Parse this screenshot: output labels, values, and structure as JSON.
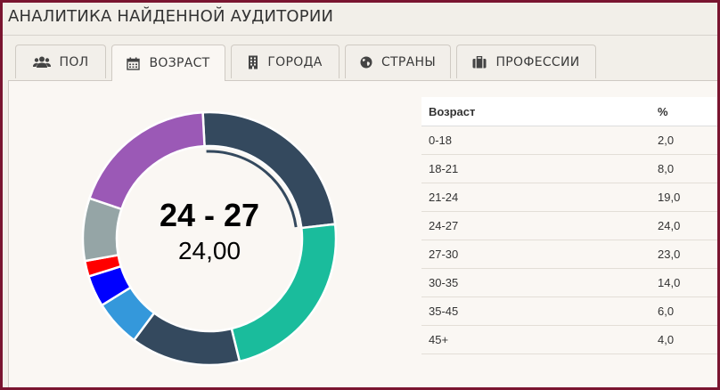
{
  "header": {
    "title": "АНАЛИТИКА НАЙДЕННОЙ АУДИТОРИИ"
  },
  "tabs": [
    {
      "label": "ПОЛ",
      "icon": "users-icon"
    },
    {
      "label": "ВОЗРАСТ",
      "icon": "calendar-icon",
      "active": true
    },
    {
      "label": "ГОРОДА",
      "icon": "building-icon"
    },
    {
      "label": "СТРАНЫ",
      "icon": "globe-icon"
    },
    {
      "label": "ПРОФЕССИИ",
      "icon": "briefcase-icon"
    }
  ],
  "chart_data": {
    "type": "pie",
    "categories": [
      "24-27",
      "27-30",
      "30-35",
      "35-45",
      "45+",
      "0-18",
      "18-21",
      "21-24"
    ],
    "values": [
      24.0,
      23.0,
      14.0,
      6.0,
      4.0,
      2.0,
      8.0,
      19.0
    ],
    "colors": [
      "#34495e",
      "#1abc9c",
      "#34495e",
      "#3498db",
      "#0000ff",
      "#ff0000",
      "#95a5a6",
      "#9b59b6"
    ],
    "highlighted": "24-27",
    "center_label": "24 - 27",
    "center_value": "24,00"
  },
  "table": {
    "headers": [
      "Возраст",
      "%"
    ],
    "rows": [
      [
        "0-18",
        "2,0"
      ],
      [
        "18-21",
        "8,0"
      ],
      [
        "21-24",
        "19,0"
      ],
      [
        "24-27",
        "24,0"
      ],
      [
        "27-30",
        "23,0"
      ],
      [
        "30-35",
        "14,0"
      ],
      [
        "35-45",
        "6,0"
      ],
      [
        "45+",
        "4,0"
      ]
    ]
  }
}
